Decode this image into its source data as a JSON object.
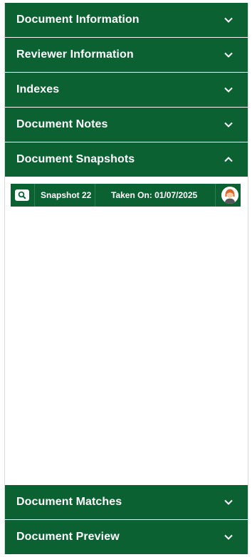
{
  "accordion": {
    "document_information": "Document Information",
    "reviewer_information": "Reviewer Information",
    "indexes": "Indexes",
    "document_notes": "Document Notes",
    "document_snapshots": "Document Snapshots",
    "document_matches": "Document Matches",
    "document_preview": "Document Preview"
  },
  "snapshots": {
    "items": [
      {
        "name": "Snapshot 22",
        "taken_on": "Taken On: 01/07/2025",
        "icon": "search-icon",
        "avatar": "user-avatar"
      }
    ]
  },
  "colors": {
    "header_green": "#0b6132",
    "text": "#ffffff"
  }
}
